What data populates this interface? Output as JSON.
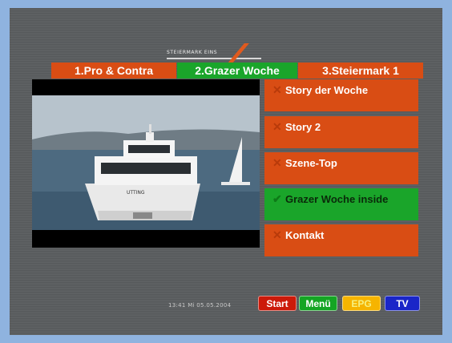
{
  "logo": {
    "text": "STEIERMARK EINS",
    "accent_color": "#e05a1e"
  },
  "tabs": [
    {
      "label": "1.Pro & Contra",
      "color": "#d94d14",
      "active": false
    },
    {
      "label": "2.Grazer Woche",
      "color": "#1aa52a",
      "active": true
    },
    {
      "label": "3.Steiermark 1",
      "color": "#d94d14",
      "active": false
    }
  ],
  "video": {
    "description_icon": "video-frame"
  },
  "menu": [
    {
      "label": "Story der Woche",
      "icon": "x-icon",
      "selected": false
    },
    {
      "label": "Story 2",
      "icon": "x-icon",
      "selected": false
    },
    {
      "label": "Szene-Top",
      "icon": "x-icon",
      "selected": false
    },
    {
      "label": "Grazer Woche inside",
      "icon": "check-icon",
      "selected": true
    },
    {
      "label": "Kontakt",
      "icon": "x-icon",
      "selected": false
    }
  ],
  "status": {
    "datetime": "13:41  Mi 05.05.2004"
  },
  "buttons": {
    "start": "Start",
    "menu": "Menü",
    "epg": "EPG",
    "tv": "TV"
  },
  "colors": {
    "orange": "#d94d14",
    "green": "#1aa52a",
    "background": "#5a5d5f",
    "frame": "#8fb3df"
  }
}
